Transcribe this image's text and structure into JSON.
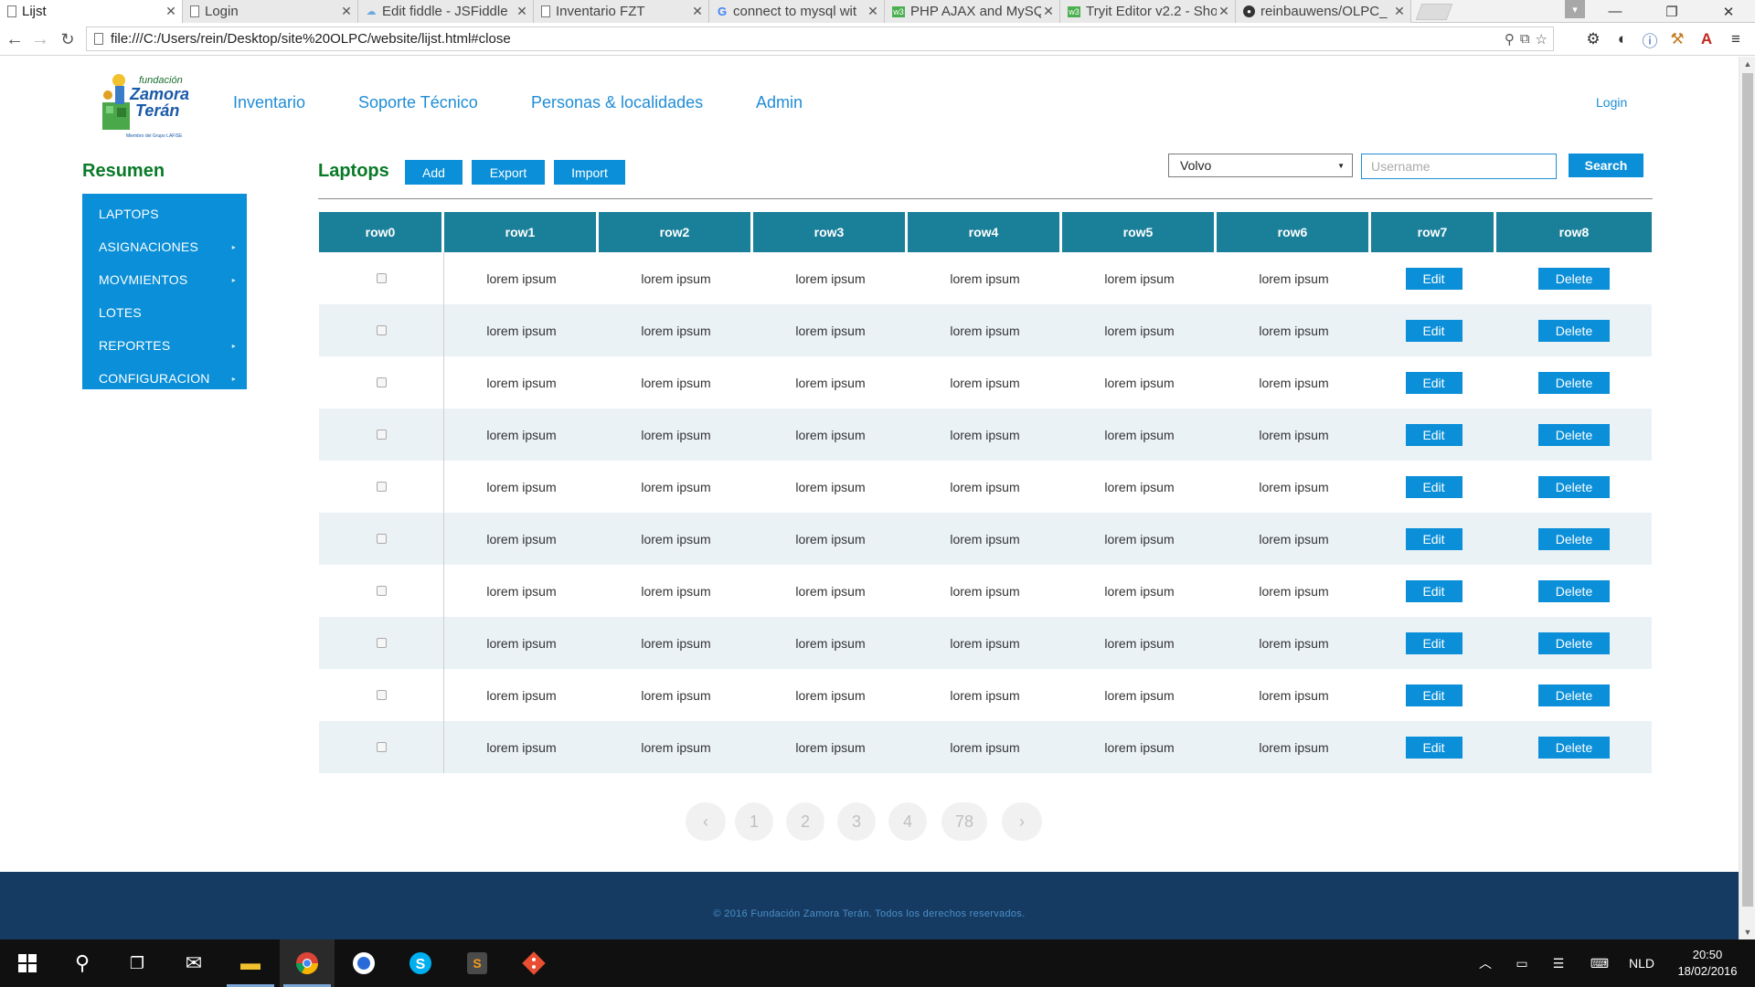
{
  "browser": {
    "tabs": [
      {
        "label": "Lijst",
        "icon": "page-icon",
        "active": true
      },
      {
        "label": "Login",
        "icon": "page-icon",
        "active": false
      },
      {
        "label": "Edit fiddle - JSFiddle",
        "icon": "jsfiddle-icon",
        "active": false
      },
      {
        "label": "Inventario FZT",
        "icon": "page-icon",
        "active": false
      },
      {
        "label": "connect to mysql wit",
        "icon": "google-icon",
        "active": false
      },
      {
        "label": "PHP AJAX and MySQ",
        "icon": "w3schools-icon",
        "active": false
      },
      {
        "label": "Tryit Editor v2.2 - Sho",
        "icon": "w3schools-icon",
        "active": false
      },
      {
        "label": "reinbauwens/OLPC_",
        "icon": "github-icon",
        "active": false
      }
    ],
    "url": "file:///C:/Users/rein/Desktop/site%20OLPC/website/lijst.html#close"
  },
  "site": {
    "logo": {
      "line1": "fundación",
      "line2": "Zamora",
      "line3": "Terán",
      "line4": "Miembro del Grupo LAFISE"
    },
    "nav": [
      "Inventario",
      "Soporte Técnico",
      "Personas & localidades",
      "Admin"
    ],
    "login_label": "Login"
  },
  "sidebar": {
    "title": "Resumen",
    "items": [
      {
        "label": "LAPTOPS",
        "has_submenu": false
      },
      {
        "label": "ASIGNACIONES",
        "has_submenu": true
      },
      {
        "label": "MOVMIENTOS",
        "has_submenu": true
      },
      {
        "label": "LOTES",
        "has_submenu": false
      },
      {
        "label": "REPORTES",
        "has_submenu": true
      },
      {
        "label": "CONFIGURACION",
        "has_submenu": true
      }
    ]
  },
  "content": {
    "title": "Laptops",
    "add_label": "Add",
    "export_label": "Export",
    "import_label": "Import",
    "select_value": "Volvo",
    "username_placeholder": "Username",
    "search_label": "Search"
  },
  "table": {
    "headers": [
      "row0",
      "row1",
      "row2",
      "row3",
      "row4",
      "row5",
      "row6",
      "row7",
      "row8"
    ],
    "cell_text": "lorem ipsum",
    "edit_label": "Edit",
    "delete_label": "Delete",
    "row_count": 10
  },
  "pagination": {
    "prev": "‹",
    "pages": [
      "1",
      "2",
      "3",
      "4",
      "78"
    ],
    "next": "›"
  },
  "footer": {
    "text": "© 2016 Fundación Zamora Terán. Todos los derechos reservados."
  },
  "taskbar": {
    "language": "NLD",
    "time": "20:50",
    "date": "18/02/2016"
  },
  "colors": {
    "accent_blue": "#0a8fd8",
    "title_green": "#0a7a28",
    "table_header": "#1a7f99",
    "footer_bg": "#163b62"
  }
}
